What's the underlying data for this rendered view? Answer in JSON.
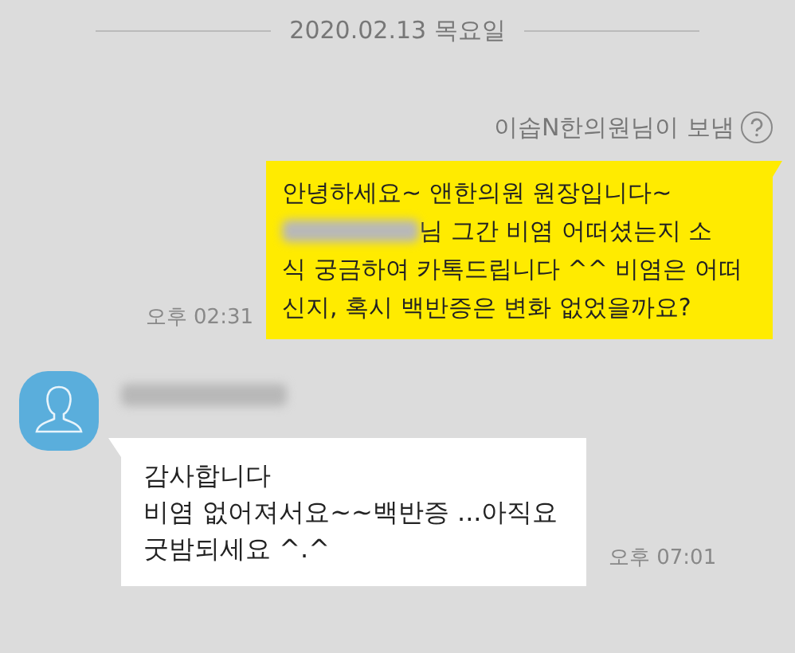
{
  "date_divider": "2020.02.13 목요일",
  "messages": [
    {
      "kind": "sent",
      "sender_note": "이솝N한의원님이 보냄",
      "lines": [
        "안녕하세요~ 앤한의원 원장입니다~",
        "님 그간 비염 어떠셨는지 소",
        "식 궁금하여 카톡드립니다 ^^ 비염은 어떠신지, 혹시 백반증은 변화 없었을까요?"
      ],
      "time": "오후 02:31"
    },
    {
      "kind": "received",
      "lines": [
        "감사합니다",
        "비염 없어져서요~~백반증 ...아직요",
        "굿밤되세요 ^.^"
      ],
      "time": "오후 07:01"
    }
  ]
}
